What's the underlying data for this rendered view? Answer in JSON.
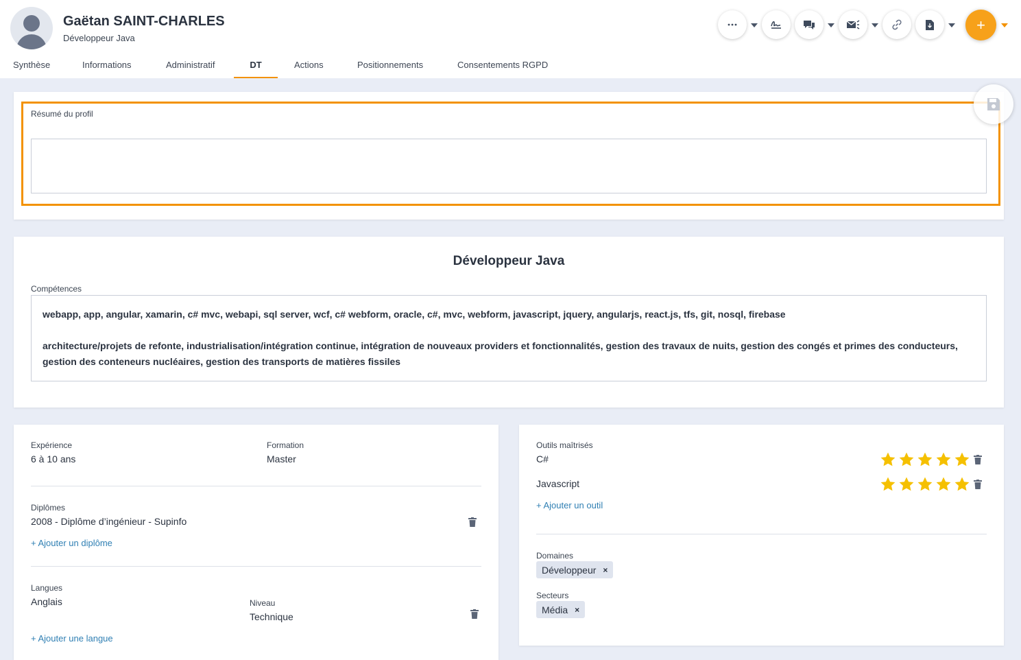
{
  "profile": {
    "name": "Gaëtan SAINT-CHARLES",
    "job_title": "Développeur Java"
  },
  "tabs": [
    {
      "label": "Synthèse"
    },
    {
      "label": "Informations"
    },
    {
      "label": "Administratif"
    },
    {
      "label": "DT",
      "active": true
    },
    {
      "label": "Actions"
    },
    {
      "label": "Positionnements"
    },
    {
      "label": "Consentements RGPD"
    }
  ],
  "toolbar": {
    "buttons": [
      "more-icon",
      "signature-icon",
      "chat-icon",
      "mail-icon",
      "link-icon",
      "document-icon"
    ],
    "add_label": "+",
    "accent": "#f7a11a"
  },
  "summary": {
    "label": "Résumé du profil",
    "value": ""
  },
  "dt": {
    "title": "Développeur Java",
    "skills_label": "Compétences",
    "skills_p1": "webapp, app, angular, xamarin, c# mvc, webapi, sql server, wcf, c# webform, oracle, c#, mvc, webform, javascript, jquery, angularjs, react.js, tfs, git, nosql, firebase",
    "skills_p2": "architecture/projets de refonte, industrialisation/intégration continue, intégration de nouveaux providers et fonctionnalités, gestion des travaux de nuits, gestion des congés et primes des conducteurs, gestion des conteneurs nucléaires, gestion des transports de matières fissiles"
  },
  "left": {
    "experience_label": "Expérience",
    "experience_value": "6 à 10 ans",
    "formation_label": "Formation",
    "formation_value": "Master",
    "diplomes_label": "Diplômes",
    "diplome_1": "2008 - Diplôme d’ingénieur - Supinfo",
    "add_diplome": "+ Ajouter un diplôme",
    "langues_label": "Langues",
    "langue_1": "Anglais",
    "niveau_label": "Niveau",
    "niveau_1": "Technique",
    "add_langue": "+ Ajouter une langue"
  },
  "right": {
    "outils_label": "Outils maîtrisés",
    "tools": [
      {
        "name": "C#",
        "rating": 5
      },
      {
        "name": "Javascript",
        "rating": 5
      }
    ],
    "add_outil": "+ Ajouter un outil",
    "domaines_label": "Domaines",
    "domaine_1": "Développeur",
    "secteurs_label": "Secteurs",
    "secteur_1": "Média",
    "chip_remove": "×",
    "star_color": "#f5c000"
  }
}
